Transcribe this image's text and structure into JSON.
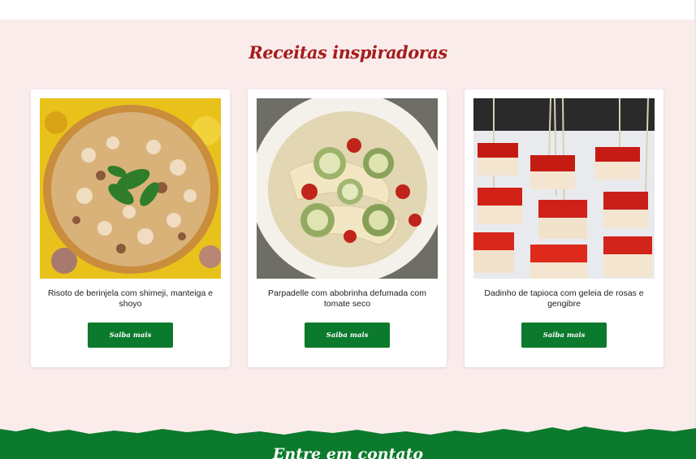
{
  "section": {
    "title": "Receitas inspiradoras"
  },
  "recipes": [
    {
      "caption": "Risoto de berinjela com shimeji, manteiga e shoyo",
      "button": "Saiba mais",
      "image": "risotto-photo"
    },
    {
      "caption": "Parpadelle com abobrinha defumada com tomate seco",
      "button": "Saiba mais",
      "image": "pappardelle-photo"
    },
    {
      "caption": "Dadinho de tapioca com geleia de rosas e gengibre",
      "button": "Saiba mais",
      "image": "tapioca-cubes-photo"
    }
  ],
  "footer": {
    "title": "Entre em contato"
  },
  "colors": {
    "accent": "#a51d1d",
    "button": "#0b7a2c",
    "background": "#fbecec",
    "footer": "#0b7a2c"
  }
}
